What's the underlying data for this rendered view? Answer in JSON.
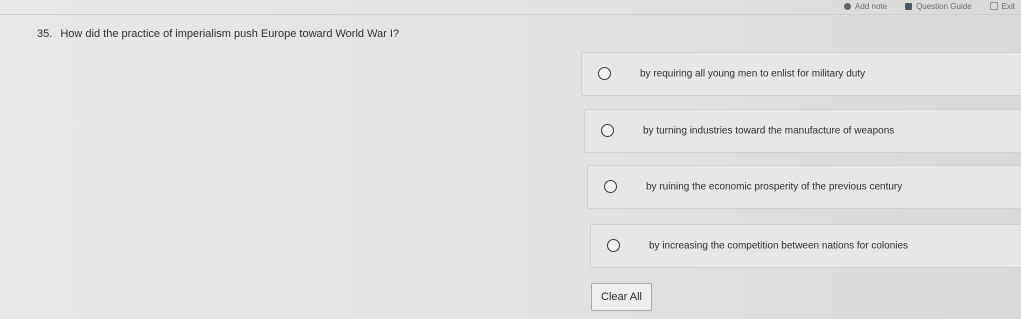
{
  "toolbar": {
    "add_note_label": "Add note",
    "question_guide_label": "Question Guide",
    "exit_label": "Exit"
  },
  "question": {
    "number": "35.",
    "text": "How did the practice of imperialism push Europe toward World War I?"
  },
  "options": [
    {
      "label": "by requiring all young men to enlist for military duty",
      "selected": false
    },
    {
      "label": "by turning industries toward the manufacture of weapons",
      "selected": false
    },
    {
      "label": "by ruining the economic prosperity of the previous century",
      "selected": false
    },
    {
      "label": "by increasing the competition between nations for colonies",
      "selected": false
    }
  ],
  "clear_all_label": "Clear All"
}
